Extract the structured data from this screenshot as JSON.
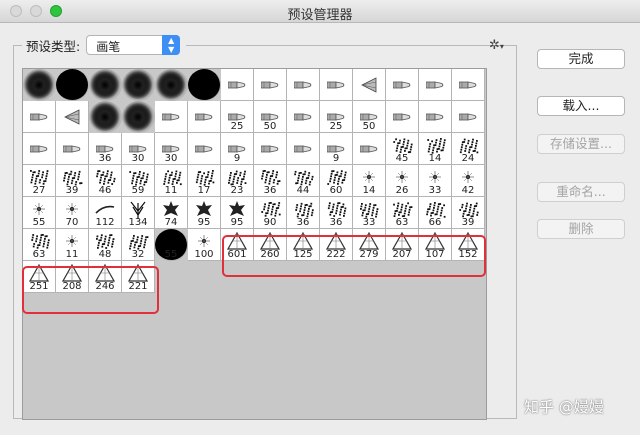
{
  "window": {
    "title": "预设管理器"
  },
  "preset_type": {
    "label": "预设类型:",
    "selected": "画笔"
  },
  "settings": {
    "icon": "gear-icon"
  },
  "buttons": {
    "done": "完成",
    "load": "载入...",
    "save": "存储设置...",
    "rename": "重命名...",
    "delete": "删除"
  },
  "watermark": "知乎 @嫚嫚",
  "highlight_color": "#e0303a",
  "brushes": [
    {
      "kind": "soft",
      "num": ""
    },
    {
      "kind": "hard",
      "num": ""
    },
    {
      "kind": "soft",
      "num": ""
    },
    {
      "kind": "soft",
      "num": ""
    },
    {
      "kind": "soft",
      "num": ""
    },
    {
      "kind": "hard",
      "num": ""
    },
    {
      "kind": "tip",
      "num": ""
    },
    {
      "kind": "tip",
      "num": ""
    },
    {
      "kind": "tip",
      "num": ""
    },
    {
      "kind": "tip",
      "num": ""
    },
    {
      "kind": "fan",
      "num": ""
    },
    {
      "kind": "tip",
      "num": ""
    },
    {
      "kind": "tip",
      "num": ""
    },
    {
      "kind": "tip",
      "num": ""
    },
    {
      "kind": "tip",
      "num": ""
    },
    {
      "kind": "fan",
      "num": ""
    },
    {
      "kind": "soft",
      "num": ""
    },
    {
      "kind": "soft",
      "num": ""
    },
    {
      "kind": "tip",
      "num": ""
    },
    {
      "kind": "tip",
      "num": ""
    },
    {
      "kind": "tip",
      "num": "25"
    },
    {
      "kind": "tip",
      "num": "50"
    },
    {
      "kind": "tip",
      "num": ""
    },
    {
      "kind": "tip",
      "num": "25"
    },
    {
      "kind": "tip",
      "num": "50"
    },
    {
      "kind": "tip",
      "num": ""
    },
    {
      "kind": "tip",
      "num": ""
    },
    {
      "kind": "tip",
      "num": ""
    },
    {
      "kind": "tip",
      "num": ""
    },
    {
      "kind": "tip",
      "num": ""
    },
    {
      "kind": "tip",
      "num": "36"
    },
    {
      "kind": "tip",
      "num": "30"
    },
    {
      "kind": "tip",
      "num": "30"
    },
    {
      "kind": "tip",
      "num": ""
    },
    {
      "kind": "tip",
      "num": "9"
    },
    {
      "kind": "tip",
      "num": ""
    },
    {
      "kind": "tip",
      "num": ""
    },
    {
      "kind": "tip",
      "num": "9"
    },
    {
      "kind": "tip",
      "num": ""
    },
    {
      "kind": "sp",
      "num": "45"
    },
    {
      "kind": "sp",
      "num": "14"
    },
    {
      "kind": "sp",
      "num": "24"
    },
    {
      "kind": "sp",
      "num": "27"
    },
    {
      "kind": "sp",
      "num": "39"
    },
    {
      "kind": "sp",
      "num": "46"
    },
    {
      "kind": "sp",
      "num": "59"
    },
    {
      "kind": "sp",
      "num": "11"
    },
    {
      "kind": "sp",
      "num": "17"
    },
    {
      "kind": "sp",
      "num": "23"
    },
    {
      "kind": "sp",
      "num": "36"
    },
    {
      "kind": "sp",
      "num": "44"
    },
    {
      "kind": "sp",
      "num": "60"
    },
    {
      "kind": "sn",
      "num": "14"
    },
    {
      "kind": "sn",
      "num": "26"
    },
    {
      "kind": "sn",
      "num": "33"
    },
    {
      "kind": "sn",
      "num": "42"
    },
    {
      "kind": "sn",
      "num": "55"
    },
    {
      "kind": "sn",
      "num": "70"
    },
    {
      "kind": "scat",
      "num": "112"
    },
    {
      "kind": "tree",
      "num": "134"
    },
    {
      "kind": "leaf",
      "num": "74"
    },
    {
      "kind": "leaf",
      "num": "95"
    },
    {
      "kind": "leaf",
      "num": "95"
    },
    {
      "kind": "sp",
      "num": "90"
    },
    {
      "kind": "sp",
      "num": "36"
    },
    {
      "kind": "sp",
      "num": "36"
    },
    {
      "kind": "sp",
      "num": "33"
    },
    {
      "kind": "sp",
      "num": "63"
    },
    {
      "kind": "sp",
      "num": "66"
    },
    {
      "kind": "sp",
      "num": "39"
    },
    {
      "kind": "sp",
      "num": "63"
    },
    {
      "kind": "sn",
      "num": "11"
    },
    {
      "kind": "sp",
      "num": "48"
    },
    {
      "kind": "sp",
      "num": "32"
    },
    {
      "kind": "hard",
      "num": "55"
    },
    {
      "kind": "sn",
      "num": "100"
    },
    {
      "kind": "tri",
      "num": "601"
    },
    {
      "kind": "tri",
      "num": "260"
    },
    {
      "kind": "tri",
      "num": "125"
    },
    {
      "kind": "tri",
      "num": "222"
    },
    {
      "kind": "tri",
      "num": "279"
    },
    {
      "kind": "tri",
      "num": "207"
    },
    {
      "kind": "tri",
      "num": "107"
    },
    {
      "kind": "tri",
      "num": "152"
    },
    {
      "kind": "tri",
      "num": "251"
    },
    {
      "kind": "tri",
      "num": "208"
    },
    {
      "kind": "tri",
      "num": "246"
    },
    {
      "kind": "tri",
      "num": "221"
    }
  ]
}
